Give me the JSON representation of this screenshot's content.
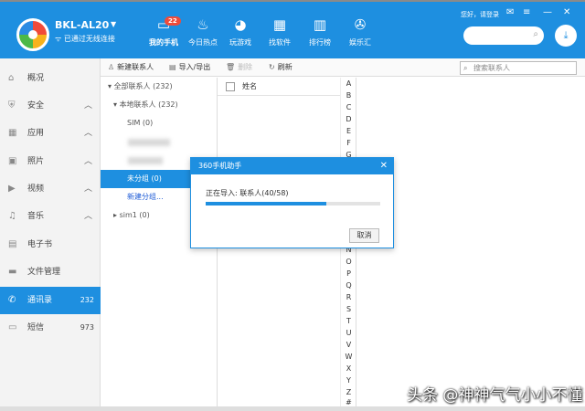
{
  "header": {
    "device_name": "BKL-AL20",
    "device_status": "已通过无线连接",
    "login_text": "您好，请登录",
    "nav": [
      {
        "label": "我的手机",
        "icon": "phone-icon",
        "badge": "22"
      },
      {
        "label": "今日热点",
        "icon": "flame-icon"
      },
      {
        "label": "玩游戏",
        "icon": "gamepad-icon"
      },
      {
        "label": "找软件",
        "icon": "apps-icon"
      },
      {
        "label": "排行榜",
        "icon": "bar-chart-icon"
      },
      {
        "label": "娱乐汇",
        "icon": "film-reel-icon"
      }
    ],
    "colors": {
      "primary": "#1e8fe0",
      "accent": "#f04b3a"
    }
  },
  "sidebar": {
    "items": [
      {
        "label": "概况",
        "icon": "home-icon"
      },
      {
        "label": "安全",
        "icon": "shield-icon"
      },
      {
        "label": "应用",
        "icon": "grid-icon"
      },
      {
        "label": "照片",
        "icon": "photo-icon"
      },
      {
        "label": "视频",
        "icon": "video-icon"
      },
      {
        "label": "音乐",
        "icon": "music-icon"
      },
      {
        "label": "电子书",
        "icon": "book-icon"
      },
      {
        "label": "文件管理",
        "icon": "folder-icon"
      },
      {
        "label": "通讯录",
        "icon": "phone-book-icon",
        "count": "232"
      },
      {
        "label": "短信",
        "icon": "message-icon",
        "count": "973"
      }
    ]
  },
  "toolbar": {
    "new_contact": "新建联系人",
    "import_export": "导入/导出",
    "delete": "删除",
    "refresh": "刷新",
    "search_placeholder": "搜索联系人"
  },
  "groups": {
    "all": "全部联系人 (232)",
    "local": "本地联系人 (232)",
    "sim": "SIM (0)",
    "ungrouped": "未分组 (0)",
    "new_group": "新建分组...",
    "sim1": "sim1 (0)"
  },
  "list": {
    "column_name": "姓名",
    "alphabet": [
      "A",
      "B",
      "C",
      "D",
      "E",
      "F",
      "G",
      "",
      "",
      "",
      "",
      "",
      "",
      "",
      "N",
      "O",
      "P",
      "Q",
      "R",
      "S",
      "T",
      "U",
      "V",
      "W",
      "X",
      "Y",
      "Z",
      "#"
    ]
  },
  "dialog": {
    "title": "360手机助手",
    "message": "正在导入: 联系人(40/58)",
    "progress": 0.69,
    "cancel": "取消"
  },
  "watermark": "头条 @神神气气小小不懂"
}
